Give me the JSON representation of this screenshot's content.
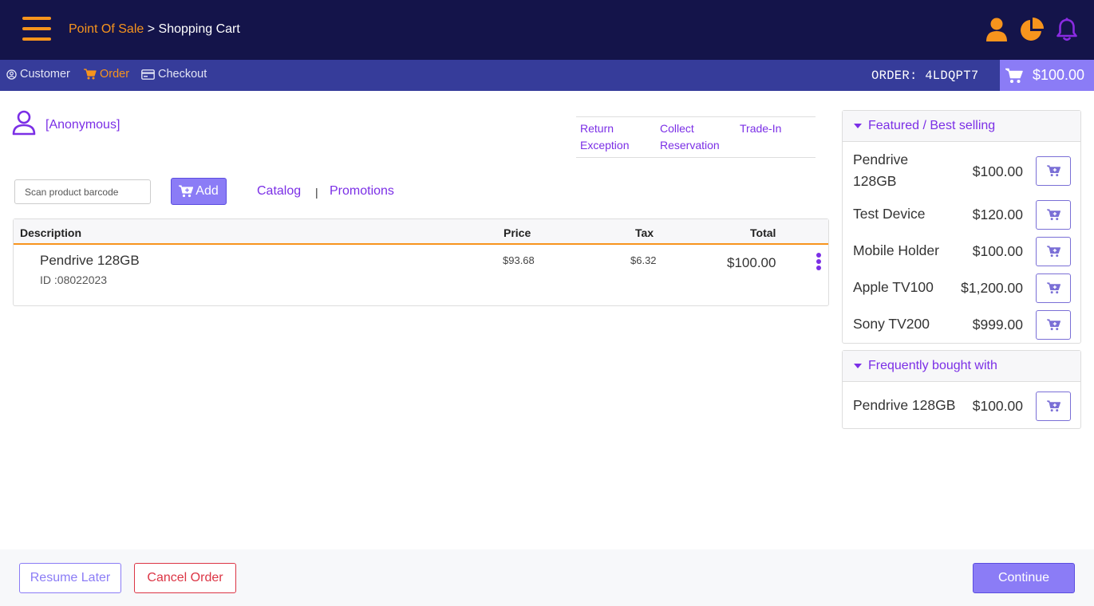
{
  "header": {
    "breadcrumb_link": "Point Of Sale",
    "breadcrumb_sep": ">",
    "breadcrumb_current": "Shopping Cart",
    "icons": [
      "user-icon",
      "pie-chart-icon",
      "bell-icon"
    ]
  },
  "subnav": {
    "items": [
      {
        "label": "Customer",
        "icon": "user-circle-icon"
      },
      {
        "label": "Order",
        "icon": "cart-icon",
        "active": true
      },
      {
        "label": "Checkout",
        "icon": "credit-card-icon"
      }
    ],
    "order_code": "ORDER: 4LDQPT7",
    "cart_total": "$100.00"
  },
  "customer": {
    "name": "[Anonymous]"
  },
  "order_actions": {
    "return_exception_1": "Return",
    "return_exception_2": "Exception",
    "collect_reservation_1": "Collect",
    "collect_reservation_2": "Reservation",
    "trade_in": "Trade-In"
  },
  "product_entry": {
    "barcode_placeholder": "Scan product barcode",
    "add_label": "Add",
    "catalog_label": "Catalog",
    "separator": "|",
    "promotions_label": "Promotions"
  },
  "cart_table": {
    "columns": [
      "Description",
      "Price",
      "Tax",
      "Total"
    ],
    "rows": [
      {
        "name": "Pendrive 128GB",
        "id": "ID :08022023",
        "price": "$93.68",
        "tax": "$6.32",
        "total": "$100.00"
      }
    ]
  },
  "featured": {
    "title": "Featured / Best selling",
    "items": [
      {
        "name": "Pendrive 128GB",
        "price": "$100.00"
      },
      {
        "name": "Test Device",
        "price": "$120.00"
      },
      {
        "name": "Mobile Holder",
        "price": "$100.00"
      },
      {
        "name": "Apple TV100",
        "price": "$1,200.00"
      },
      {
        "name": "Sony TV200",
        "price": "$999.00"
      }
    ]
  },
  "frequently_bought": {
    "title": "Frequently bought with",
    "items": [
      {
        "name": "Pendrive 128GB",
        "price": "$100.00"
      }
    ]
  },
  "footer": {
    "resume_label": "Resume Later",
    "cancel_label": "Cancel Order",
    "continue_label": "Continue"
  },
  "colors": {
    "header_bg": "#14144a",
    "subnav_bg": "#363c9a",
    "accent_orange": "#f7941d",
    "accent_purple": "#7b2fe6",
    "button_purple": "#8b7cf6",
    "danger": "#dc3545"
  }
}
